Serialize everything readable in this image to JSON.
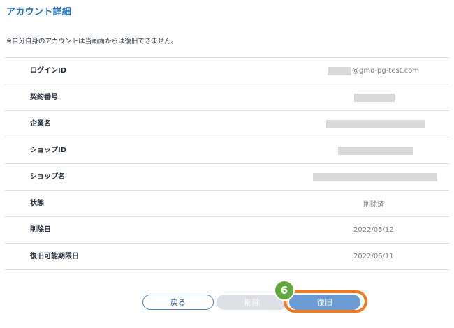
{
  "page": {
    "title": "アカウント詳細",
    "notice": "※自分自身のアカウントは当画面からは復旧できません。"
  },
  "details": {
    "login_id": {
      "label": "ログインID",
      "value_suffix": "@gmo-pg-test.com",
      "redacted": true
    },
    "contract_no": {
      "label": "契約番号",
      "redacted": true
    },
    "company_name": {
      "label": "企業名",
      "redacted": true
    },
    "shop_id": {
      "label": "ショップID",
      "redacted": true
    },
    "shop_name": {
      "label": "ショップ名",
      "redacted": true
    },
    "status": {
      "label": "状態",
      "value": "削除済"
    },
    "deleted_date": {
      "label": "削除日",
      "value": "2022/05/12"
    },
    "restore_deadline": {
      "label": "復旧可能期限日",
      "value": "2022/06/11"
    }
  },
  "buttons": {
    "back": "戻る",
    "delete": "削除",
    "restore": "復旧"
  },
  "annotation": {
    "step_number": "6"
  },
  "colors": {
    "title": "#1f6fc0",
    "highlight": "#f07a21",
    "badge": "#63a83d",
    "restore_button": "#6a9bd4",
    "back_button_border": "#4a7dc0",
    "delete_button_disabled": "#dde1e6",
    "redaction": "#d9d9d9"
  }
}
